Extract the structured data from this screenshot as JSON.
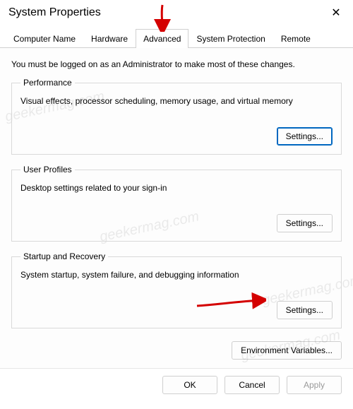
{
  "window": {
    "title": "System Properties",
    "close_glyph": "✕"
  },
  "tabs": {
    "computer_name": "Computer Name",
    "hardware": "Hardware",
    "advanced": "Advanced",
    "system_protection": "System Protection",
    "remote": "Remote"
  },
  "intro": "You must be logged on as an Administrator to make most of these changes.",
  "groups": {
    "performance": {
      "legend": "Performance",
      "desc": "Visual effects, processor scheduling, memory usage, and virtual memory",
      "button": "Settings..."
    },
    "user_profiles": {
      "legend": "User Profiles",
      "desc": "Desktop settings related to your sign-in",
      "button": "Settings..."
    },
    "startup_recovery": {
      "legend": "Startup and Recovery",
      "desc": "System startup, system failure, and debugging information",
      "button": "Settings..."
    }
  },
  "env_button": "Environment Variables...",
  "dialog": {
    "ok": "OK",
    "cancel": "Cancel",
    "apply": "Apply"
  },
  "watermark": "geekermag.com"
}
